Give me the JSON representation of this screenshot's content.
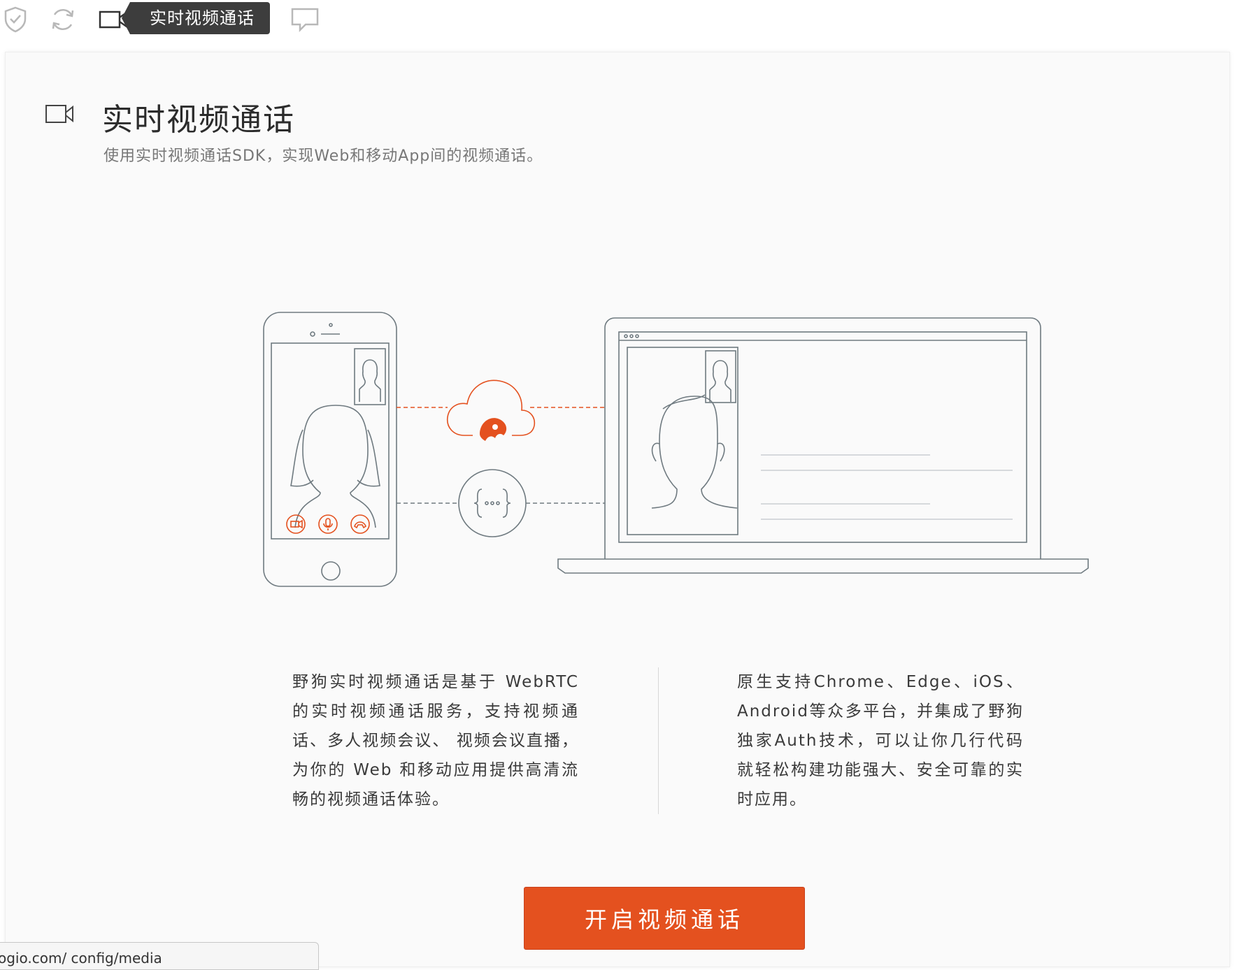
{
  "toolbar": {
    "icons": [
      "shield-check-icon",
      "refresh-icon",
      "video-camera-icon",
      "chat-bubble-icon"
    ],
    "active_tab_label": "实时视频通话"
  },
  "header": {
    "title": "实时视频通话",
    "subtitle": "使用实时视频通话SDK，实现Web和移动App间的视频通话。"
  },
  "description": {
    "left": "野狗实时视频通话是基于 WebRTC 的实时视频通话服务，支持视频通话、多人视频会议、 视频会议直播，为你的 Web 和移动应用提供高清流畅的视频通话体验。",
    "right": "原生支持Chrome、Edge、iOS、Android等众多平台，并集成了野狗独家Auth技术，可以让你几行代码就轻松构建功能强大、安全可靠的实时应用。"
  },
  "cta": {
    "label": "开启视频通话"
  },
  "status_bar": {
    "url": "ogio.com/ config/media"
  },
  "colors": {
    "accent": "#e4511f",
    "line": "#6f7a80",
    "dark_tab": "#3d3d3d"
  }
}
